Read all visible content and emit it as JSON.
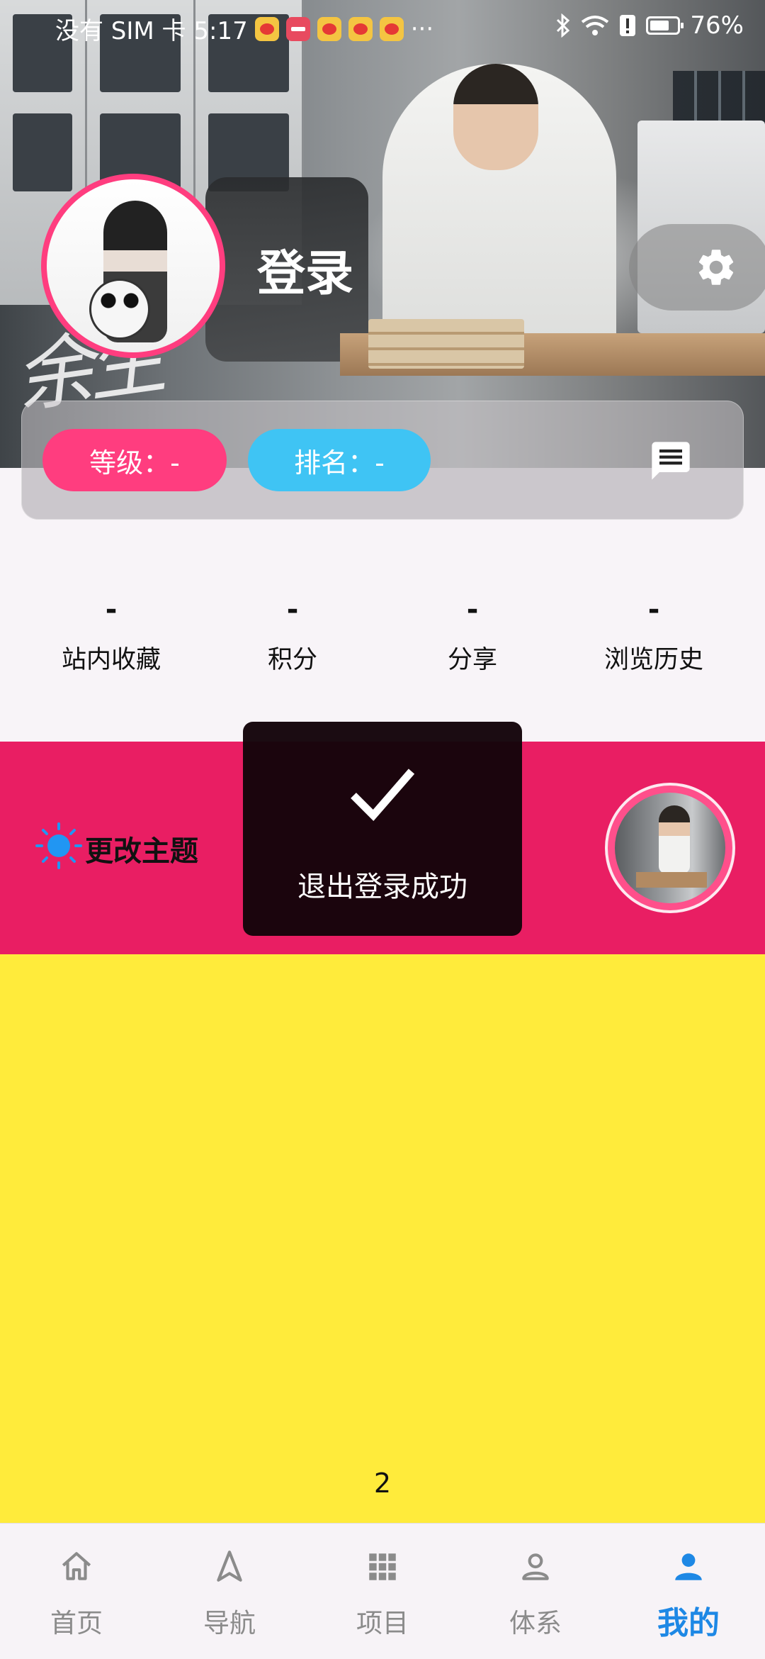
{
  "status_bar": {
    "carrier_time": "没有 SIM 卡 5:17",
    "more": "···",
    "battery": "76%"
  },
  "header": {
    "login_label": "登录",
    "watermark": "余生",
    "settings_icon": "gear-icon"
  },
  "info_card": {
    "level_label": "等级：-",
    "rank_label": "排名：-",
    "message_icon": "message-icon"
  },
  "stats": [
    {
      "value": "-",
      "label": "站内收藏"
    },
    {
      "value": "-",
      "label": "积分"
    },
    {
      "value": "-",
      "label": "分享"
    },
    {
      "value": "-",
      "label": "浏览历史"
    }
  ],
  "theme": {
    "label": "更改主题",
    "icon": "sun-icon",
    "accent": "#e91e63"
  },
  "toast": {
    "message": "退出登录成功",
    "icon": "check-icon"
  },
  "page_indicator": "2",
  "bottom_nav": {
    "items": [
      {
        "label": "首页",
        "icon": "home-icon",
        "active": false
      },
      {
        "label": "导航",
        "icon": "navigation-icon",
        "active": false
      },
      {
        "label": "项目",
        "icon": "grid-icon",
        "active": false
      },
      {
        "label": "体系",
        "icon": "person-outline-icon",
        "active": false
      },
      {
        "label": "我的",
        "icon": "person-filled-icon",
        "active": true
      }
    ],
    "active_color": "#1e88e5"
  },
  "colors": {
    "level_pill": "#ff3d7f",
    "rank_pill": "#3fc4f4",
    "yellow_area": "#ffeb3b"
  }
}
